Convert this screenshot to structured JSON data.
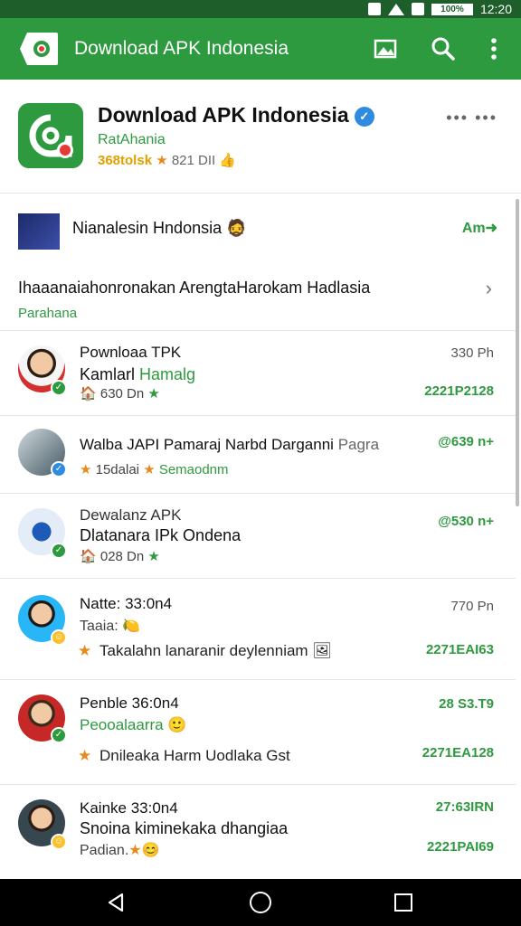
{
  "status_bar": {
    "time": "12:20",
    "battery": "100%"
  },
  "app_bar": {
    "title": "Download APK Indonesia",
    "actions": [
      "image-icon",
      "search-icon",
      "overflow-menu-icon"
    ]
  },
  "app_header": {
    "name": "Download APK Indonesia",
    "developer": "RatAhania",
    "rating": "368tolsk",
    "meta": "821 DII",
    "more": "•••  •••"
  },
  "pinned": {
    "title": "Nianalesin Hndonsia",
    "action": "Am",
    "message": "Ihaaanaiahonronakan ArengtaHarokam Hadlasia",
    "tag": "Parahana"
  },
  "chats": [
    {
      "line1": "Pownloaa TPK",
      "line2": "Kamlarl",
      "line2_green": "Hamalg",
      "line3": "630 Dn",
      "time": "330 Ph",
      "date": "2221P2128"
    },
    {
      "line1": "Walba JAPI Pamaraj Narbd Darganni",
      "line1_suffix": "Pagra",
      "line3": "15dalai",
      "line3_green": "Semaodnm",
      "time": "@639 n+",
      "date": ""
    },
    {
      "line1": "Dewalanz APK",
      "line2": "Dlatanara IPk Ondena",
      "line3": "028 Dn",
      "time": "@530 n+",
      "date": ""
    },
    {
      "line1": "Natte: 33:0n4",
      "line2": "Taaia:",
      "line3": "Takalahn lanaranir deylenniam",
      "time": "770 Pn",
      "date": "2271EAI63"
    },
    {
      "line1": "Penble 36:0n4",
      "line2_green": "Peooalaarra",
      "line3": "Dnileaka Harm Uodlaka Gst",
      "time": "28 S3.T9",
      "date": "2271EA128"
    },
    {
      "line1": "Kainke 33:0n4",
      "line2": "Snoina kiminekaka dhangiaa",
      "line3": "Padian.",
      "time": "27:63IRN",
      "date": "2221PAI69"
    }
  ]
}
